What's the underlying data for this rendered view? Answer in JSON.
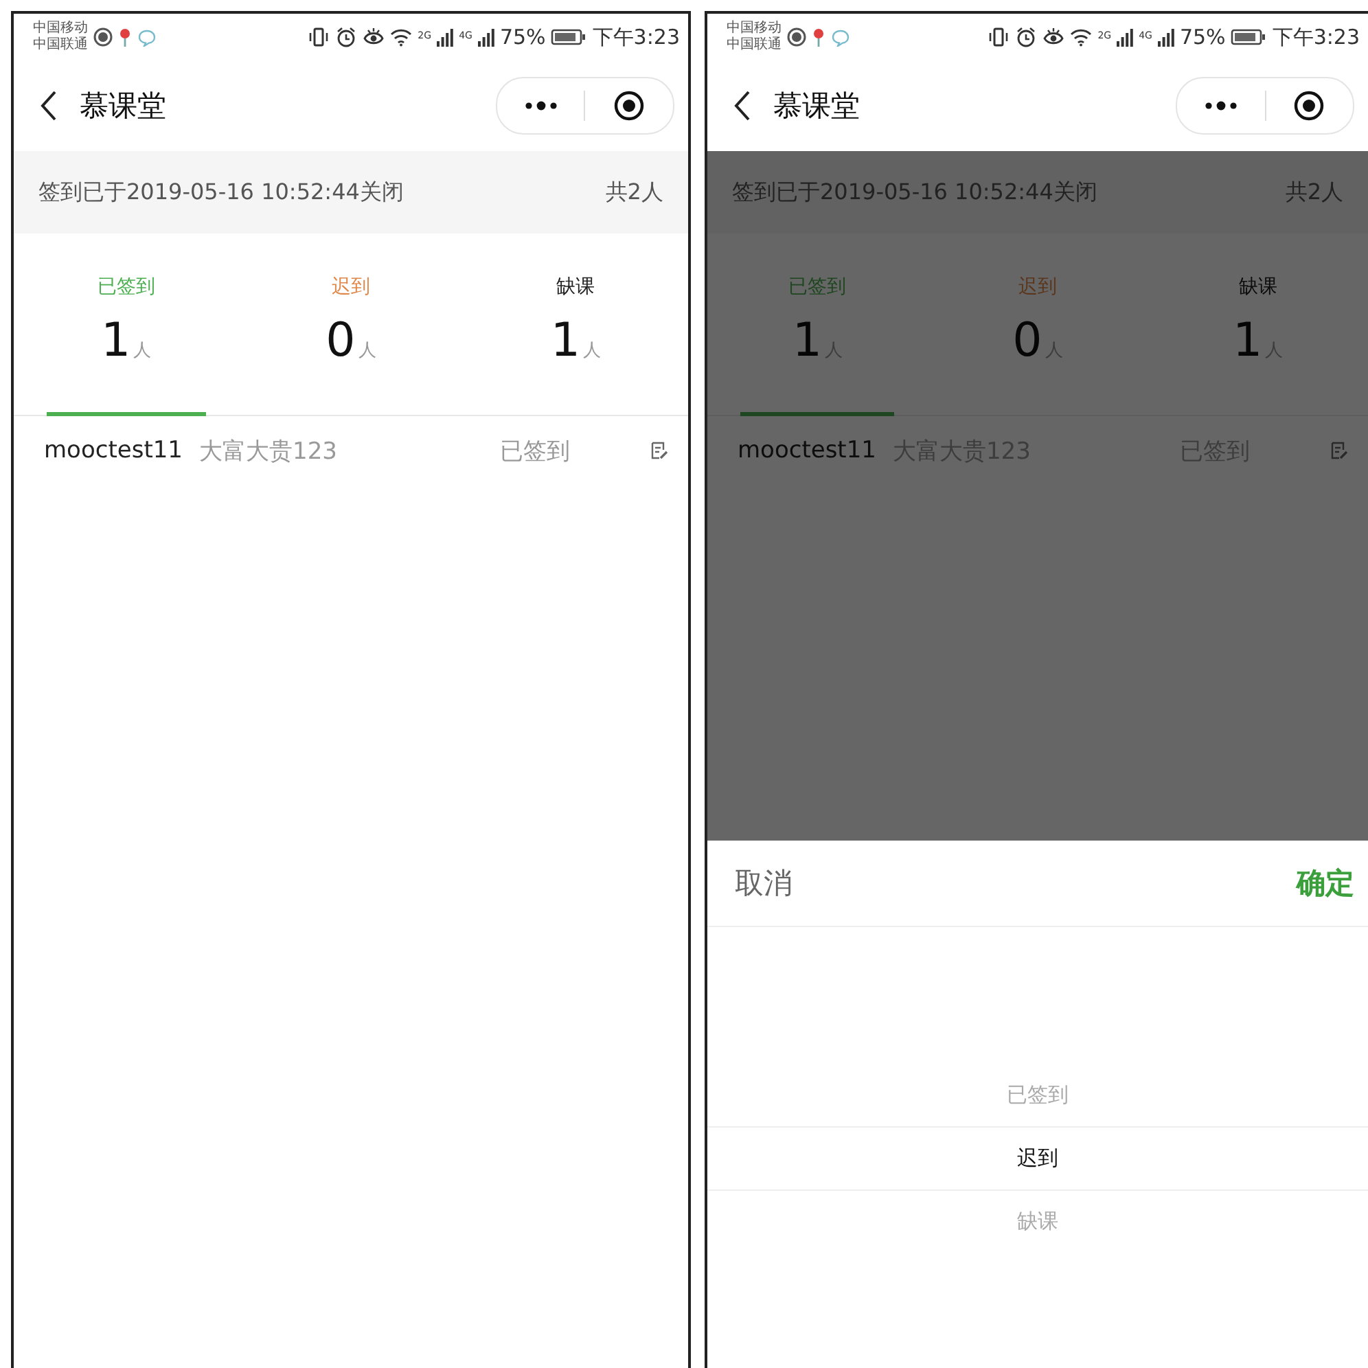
{
  "screens": [
    {
      "status_bar": {
        "carriers": [
          "中国移动",
          "中国联通"
        ],
        "network": [
          "2G",
          "4G"
        ],
        "battery": "75%",
        "time": "下午3:23"
      },
      "nav": {
        "title": "慕课堂"
      },
      "notice": {
        "text": "签到已于2019-05-16 10:52:44关闭",
        "total": "共2人"
      },
      "tabs": [
        {
          "kind": "signed",
          "label": "已签到",
          "count": "1",
          "unit": "人",
          "selected": true
        },
        {
          "kind": "late",
          "label": "迟到",
          "count": "0",
          "unit": "人",
          "selected": false
        },
        {
          "kind": "absent",
          "label": "缺课",
          "count": "1",
          "unit": "人",
          "selected": false
        }
      ],
      "students": [
        {
          "account": "mooctest11",
          "name": "大富大贵123",
          "status": "已签到"
        }
      ],
      "dimmed": false
    },
    {
      "status_bar": {
        "carriers": [
          "中国移动",
          "中国联通"
        ],
        "network": [
          "2G",
          "4G"
        ],
        "battery": "75%",
        "time": "下午3:23"
      },
      "nav": {
        "title": "慕课堂"
      },
      "notice": {
        "text": "签到已于2019-05-16 10:52:44关闭",
        "total": "共2人"
      },
      "tabs": [
        {
          "kind": "signed",
          "label": "已签到",
          "count": "1",
          "unit": "人",
          "selected": true
        },
        {
          "kind": "late",
          "label": "迟到",
          "count": "0",
          "unit": "人",
          "selected": false
        },
        {
          "kind": "absent",
          "label": "缺课",
          "count": "1",
          "unit": "人",
          "selected": false
        }
      ],
      "students": [
        {
          "account": "mooctest11",
          "name": "大富大贵123",
          "status": "已签到"
        }
      ],
      "dimmed": true,
      "picker": {
        "cancel": "取消",
        "confirm": "确定",
        "options": [
          {
            "label": "已签到",
            "selected": false
          },
          {
            "label": "迟到",
            "selected": true
          },
          {
            "label": "缺课",
            "selected": false
          }
        ]
      }
    }
  ]
}
